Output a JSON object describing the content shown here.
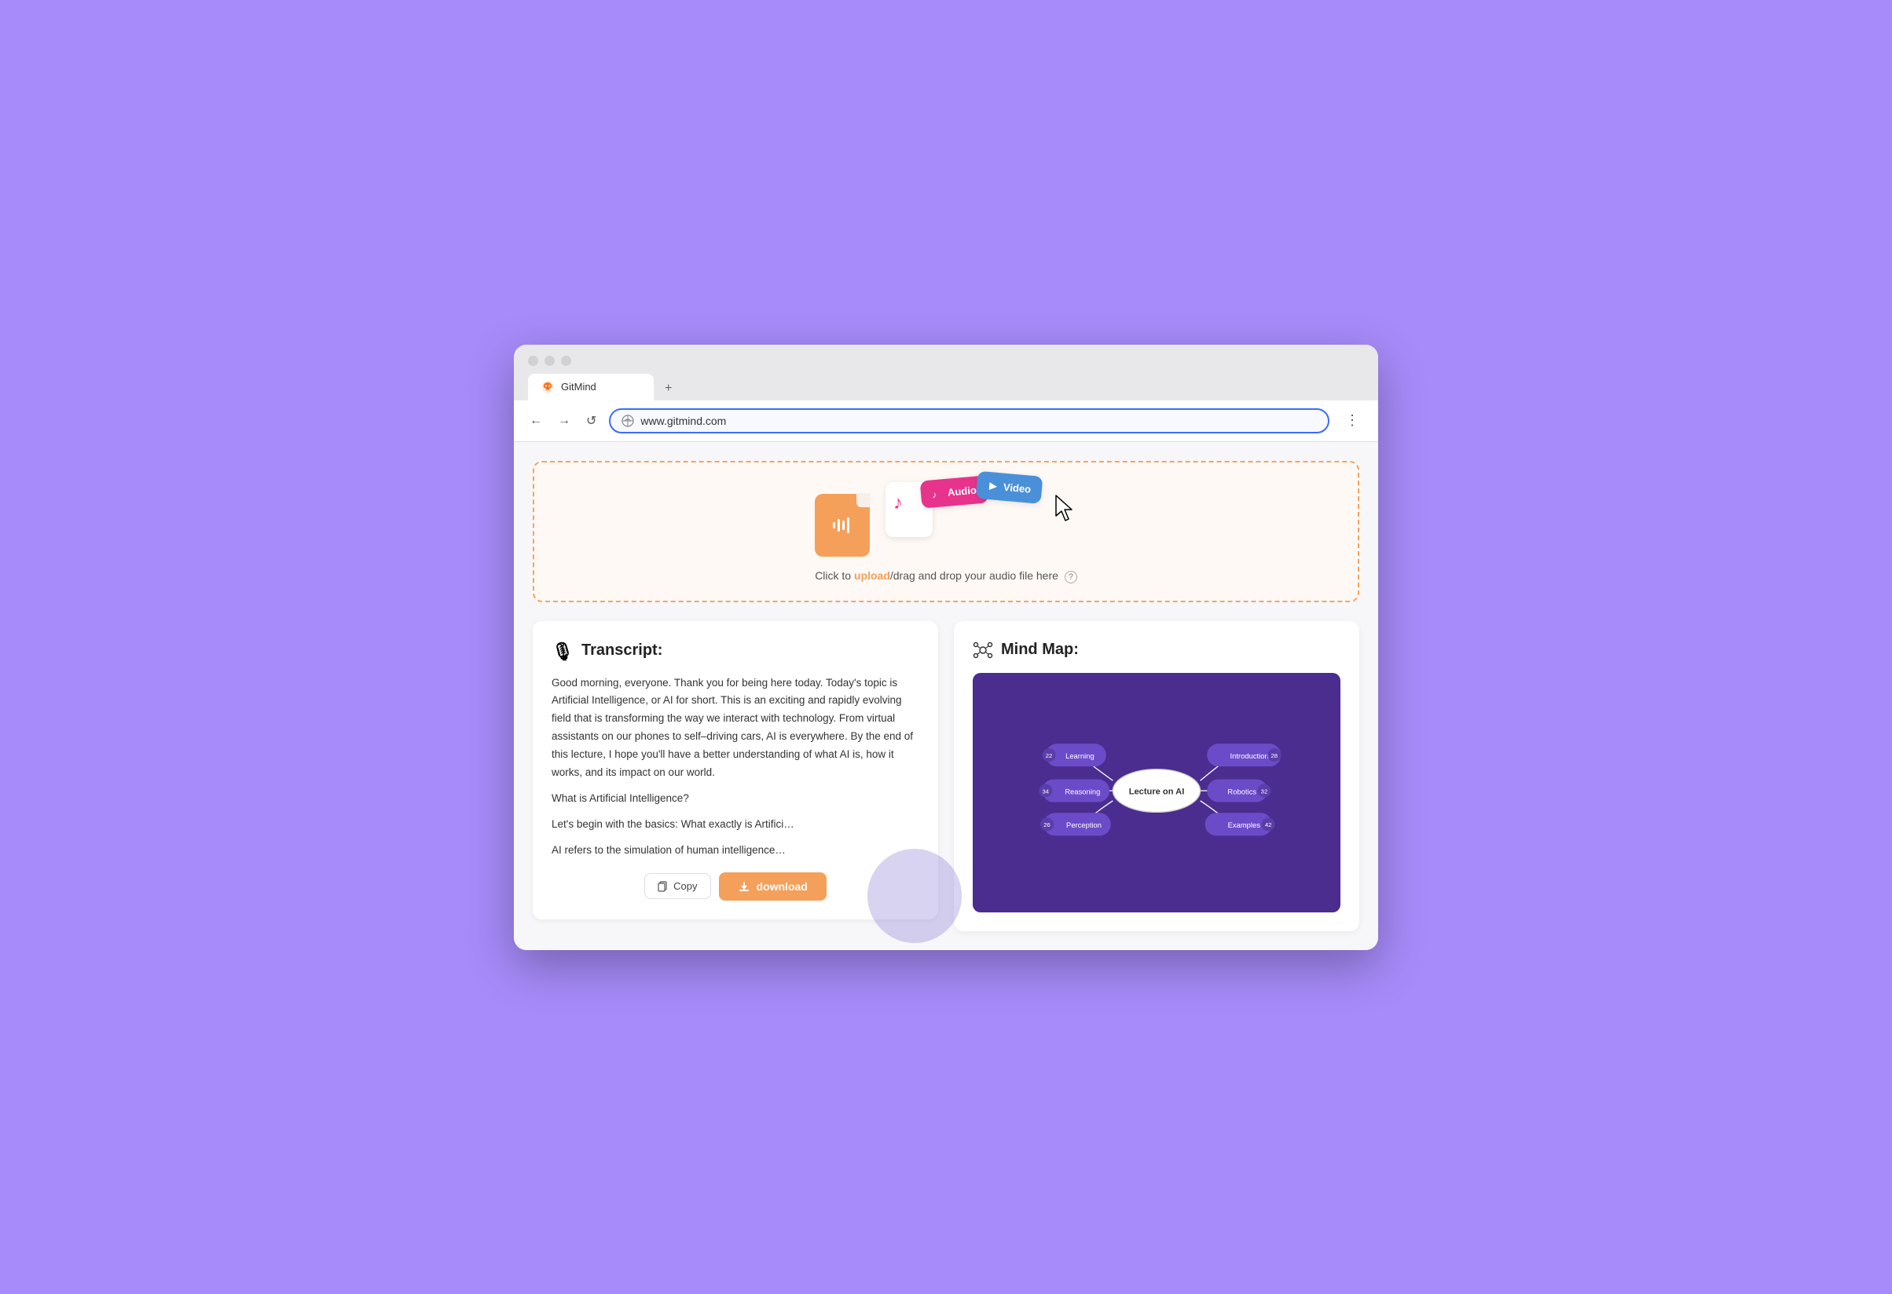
{
  "browser": {
    "tab_label": "GitMind",
    "tab_new": "+",
    "url": "www.gitmind.com",
    "nav": {
      "back": "←",
      "forward": "→",
      "refresh": "↺",
      "menu": "⋮"
    }
  },
  "upload": {
    "text_pre": "Click to ",
    "text_link": "upload",
    "text_post": "/drag and drop your audio file here",
    "help": "?",
    "audio_label": "Audio",
    "video_label": "Video"
  },
  "transcript": {
    "title": "Transcript:",
    "paragraphs": [
      "Good morning, everyone. Thank you for being here today. Today's topic is Artificial Intelligence, or AI for short. This is an exciting and rapidly evolving field that is transforming the way we interact with technology. From virtual assistants on our phones to self–driving cars, AI is everywhere. By the end of this lecture, I hope you'll have a better understanding of what AI is, how it works, and its impact on our world.",
      "What is Artificial Intelligence?",
      "Let's begin with the basics: What exactly is Artifici…",
      "AI refers to the simulation of human intelligence…"
    ],
    "copy_btn": "Copy",
    "download_btn": "download"
  },
  "mindmap": {
    "title": "Mind Map:",
    "center_label": "Lecture on AI",
    "left_nodes": [
      {
        "id": "learning",
        "label": "Learning",
        "badge": "22"
      },
      {
        "id": "reasoning",
        "label": "Reasoning",
        "badge": "34"
      },
      {
        "id": "perception",
        "label": "Perception",
        "badge": "26"
      }
    ],
    "right_nodes": [
      {
        "id": "introduction",
        "label": "Introduction",
        "badge": "28"
      },
      {
        "id": "robotics",
        "label": "Robotics",
        "badge": "32"
      },
      {
        "id": "examples",
        "label": "Examples",
        "badge": "42"
      }
    ]
  }
}
